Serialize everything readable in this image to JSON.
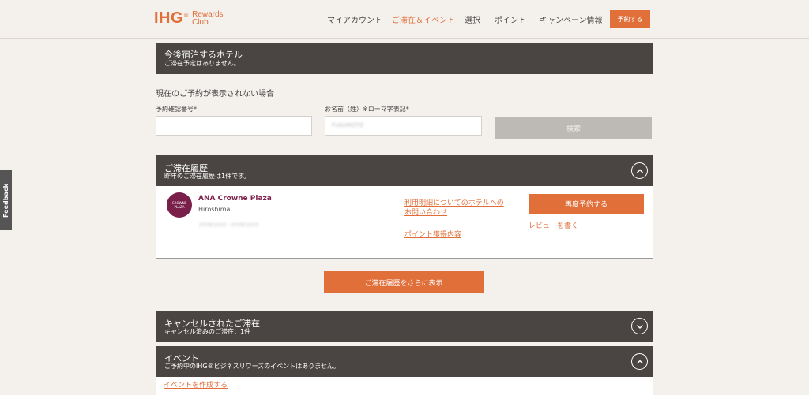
{
  "header": {
    "logo_main": "IHG",
    "logo_reg": "®",
    "logo_line1": "Rewards",
    "logo_line2": "Club",
    "nav": [
      "マイアカウント",
      "ご滞在＆イベント",
      "選択",
      "ポイント",
      "キャンペーン情報"
    ],
    "book_button": "予約する"
  },
  "upcoming": {
    "title": "今後宿泊するホテル",
    "subtitle": "ご滞在予定はありません。"
  },
  "lookup": {
    "heading": "現在のご予約が表示されない場合",
    "confirmation_label": "予約確認番号*",
    "lastname_label": "お名前（姓）※ローマ字表記*",
    "lastname_value": "FUKUMOTO",
    "search_button": "検索"
  },
  "history": {
    "title": "ご滞在履歴",
    "subtitle": "昨年のご滞在履歴は1件です。",
    "hotel_logo_line1": "CROWNE",
    "hotel_logo_line2": "PLAZA",
    "hotel_name": "ANA Crowne Plaza",
    "hotel_city": "Hiroshima",
    "dates": "2018/12/22 - 2018/12/23",
    "contact_link": "利用明細についてのホテルへのお問い合わせ",
    "points_link": "ポイント獲得内容",
    "rebook_button": "再度予約する",
    "review_link": "レビューを書く",
    "more_button": "ご滞在履歴をさらに表示"
  },
  "cancelled": {
    "title": "キャンセルされたご滞在",
    "subtitle": "キャンセル済みのご滞在：1件"
  },
  "events": {
    "title": "イベント",
    "subtitle": "ご予約中のIHG®ビジネスリワーズのイベントはありません。",
    "create_link": "イベントを作成する"
  },
  "feedback": "Feedback",
  "colors": {
    "accent": "#e06f3a",
    "panel": "#4a4543",
    "brand_hotel": "#7a1f4a"
  }
}
